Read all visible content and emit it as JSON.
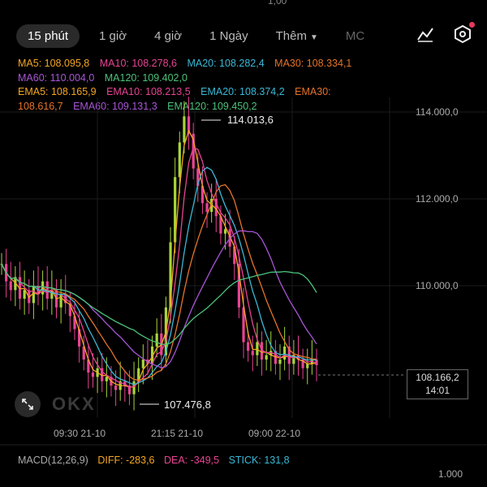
{
  "top_clip": "1,00",
  "tabs": [
    {
      "label": "15 phút",
      "active": true
    },
    {
      "label": "1 giờ"
    },
    {
      "label": "4 giờ"
    },
    {
      "label": "1 Ngày"
    },
    {
      "label": "Thêm"
    },
    {
      "label": "MC"
    }
  ],
  "icons": [
    "indicator-icon",
    "settings-icon"
  ],
  "legend": {
    "ma5": "MA5: 108.095,8",
    "ma10": "MA10: 108.278,6",
    "ma20": "MA20: 108.282,4",
    "ma30": "MA30: 108.334,1",
    "ma60": "MA60: 110.004,0",
    "ma120": "MA120: 109.402,0",
    "ema5": "EMA5: 108.165,9",
    "ema10": "EMA10: 108.213,5",
    "ema20": "EMA20: 108.374,2",
    "ema30": "EMA30:",
    "ema30_val": "108.616,7",
    "ema60": "EMA60: 109.131,3",
    "ema120": "EMA120: 109.450,2"
  },
  "colors": {
    "ma5": "#f5a623",
    "ma10": "#e84393",
    "ma20": "#3ab8d6",
    "ma30": "#e5732a",
    "ma60": "#a855d6",
    "ma120": "#4cc27a",
    "up": "#a7d63a",
    "down": "#e84393"
  },
  "y_axis": [
    "114.000,0",
    "112.000,0",
    "110.000,0"
  ],
  "x_axis": [
    "09:30 21-10",
    "21:15 21-10",
    "09:00 22-10"
  ],
  "high_label": "114.013,6",
  "low_label": "107.476,8",
  "price": {
    "value": "108.166,2",
    "countdown": "14:01"
  },
  "watermark": "OKX",
  "macd": {
    "title": "MACD(12,26,9)",
    "diff": "DIFF: -283,6",
    "dea": "DEA: -349,5",
    "stick": "STICK: 131,8",
    "axis_value": "1.000"
  },
  "chart_data": {
    "type": "line",
    "title": "",
    "ylim": [
      107000,
      115000
    ],
    "close": [
      110.5,
      110.1,
      109.9,
      110.2,
      109.7,
      109.9,
      109.6,
      110.0,
      109.8,
      110.1,
      109.7,
      109.9,
      109.5,
      109.8,
      109.6,
      109.3,
      109.0,
      108.6,
      108.3,
      108.0,
      107.9,
      108.1,
      107.8,
      107.9,
      107.7,
      107.6,
      107.8,
      107.7,
      107.5,
      107.8,
      108.1,
      108.3,
      108.2,
      108.6,
      108.9,
      108.4,
      109.5,
      111.0,
      112.5,
      113.3,
      113.9,
      113.5,
      112.7,
      112.3,
      111.9,
      111.7,
      112.0,
      111.6,
      111.2,
      111.3,
      110.9,
      110.5,
      109.5,
      108.7,
      108.5,
      108.4,
      108.7,
      108.3,
      108.4,
      108.5,
      108.2,
      108.3,
      108.6,
      108.2,
      108.4,
      108.3,
      108.1,
      108.2,
      108.3,
      108.17
    ]
  }
}
